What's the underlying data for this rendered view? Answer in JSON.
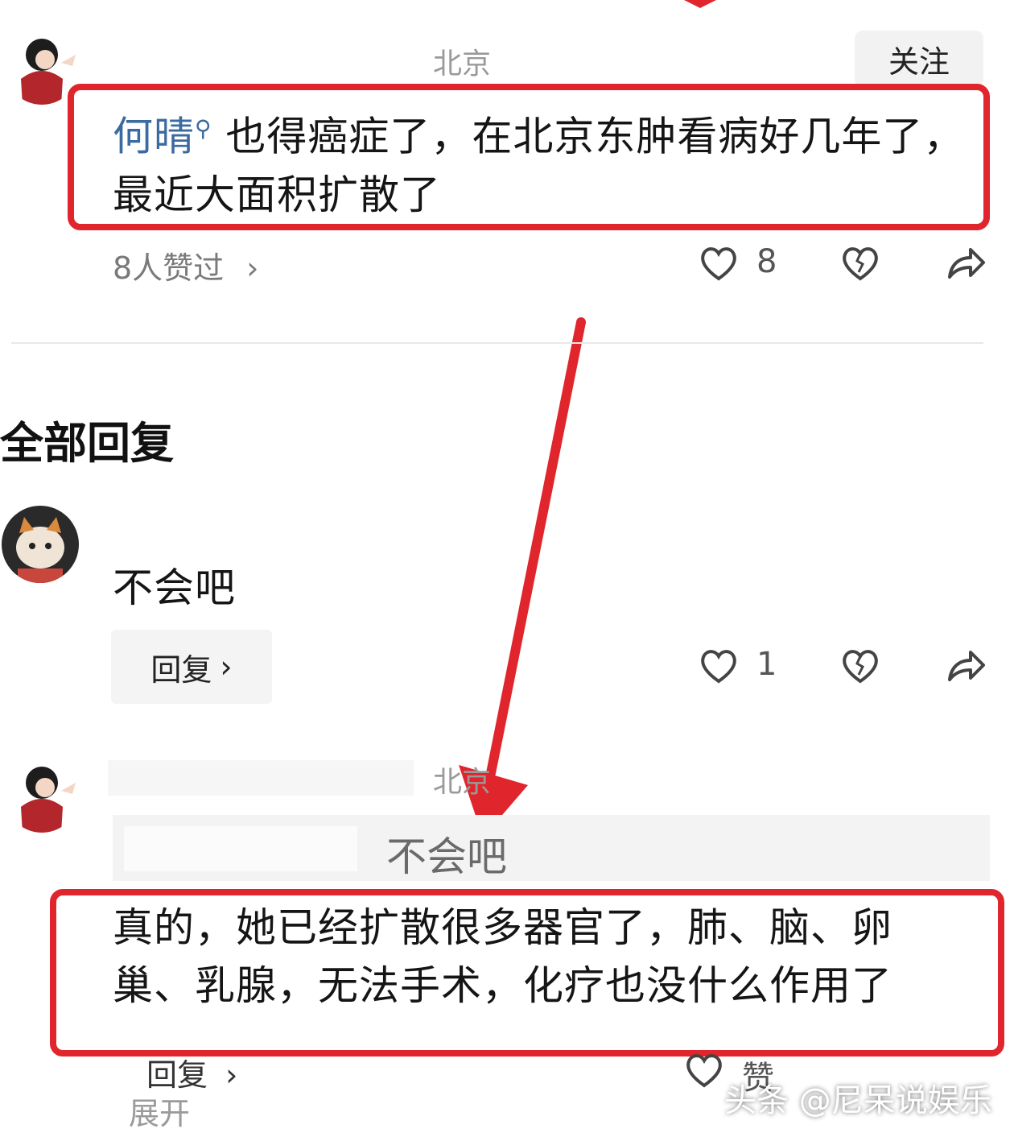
{
  "comment1": {
    "location": "北京",
    "follow_label": "关注",
    "mention": "何晴",
    "text": "也得癌症了，在北京东肿看病好几年了，最近大面积扩散了",
    "likes_summary": "8人赞过",
    "like_count": "8",
    "icons": {
      "like": "heart-icon",
      "dislike": "broken-heart-icon",
      "share": "share-arrow-icon"
    }
  },
  "section": {
    "title": "全部回复"
  },
  "reply1": {
    "text": "不会吧",
    "reply_label": "回复",
    "like_count": "1"
  },
  "reply2": {
    "location": "北京",
    "quoted_text": "不会吧",
    "text": "真的，她已经扩散很多器官了，肺、脑、卵巢、乳腺，无法手术，化疗也没什么作用了",
    "reply_label": "回复",
    "like_label": "赞",
    "collapse_label": "展开"
  },
  "watermark": "头条 @尼呆说娱乐",
  "colors": {
    "highlight_red": "#e0262c",
    "mention_blue": "#3b6aa0"
  }
}
